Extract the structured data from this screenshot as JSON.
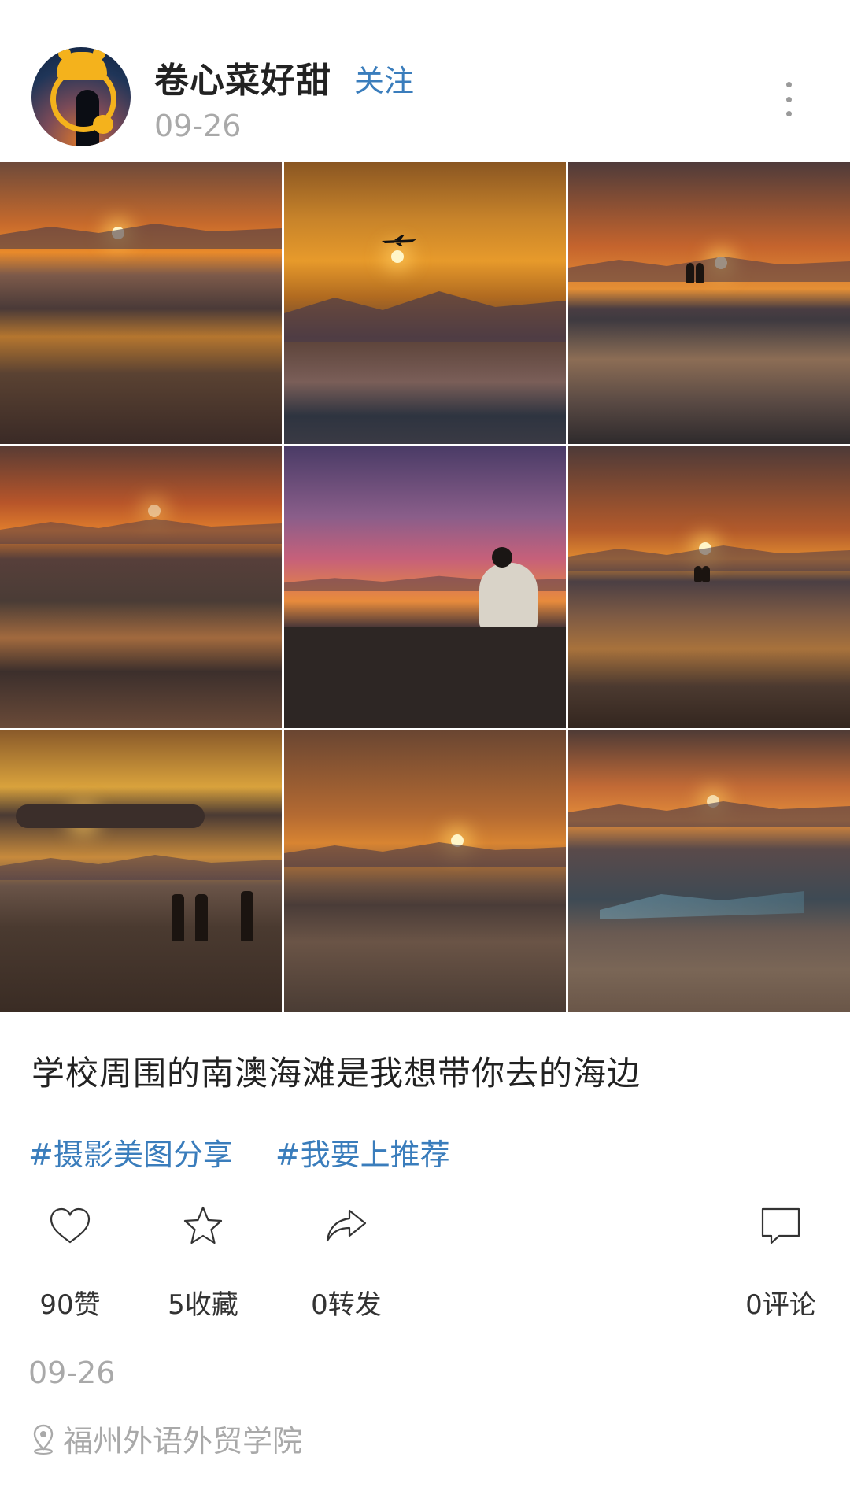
{
  "header": {
    "username": "卷心菜好甜",
    "follow_label": "关注",
    "date": "09-26"
  },
  "photos": [
    {
      "alt": "sunset-beach-1"
    },
    {
      "alt": "sunset-plane"
    },
    {
      "alt": "sunset-couple"
    },
    {
      "alt": "sunset-tidal-flat"
    },
    {
      "alt": "sunset-sitting-man"
    },
    {
      "alt": "sunset-shore"
    },
    {
      "alt": "sunset-three-people"
    },
    {
      "alt": "sunset-beach-2"
    },
    {
      "alt": "sunset-nets"
    }
  ],
  "post": {
    "caption": "学校周围的南澳海滩是我想带你去的海边",
    "tags": [
      "#摄影美图分享",
      "#我要上推荐"
    ]
  },
  "actions": {
    "like_count": "90赞",
    "favorite_count": "5收藏",
    "share_count": "0转发",
    "comment_count": "0评论"
  },
  "footer": {
    "date": "09-26",
    "location": "福州外语外贸学院"
  },
  "colors": {
    "accent": "#3a7dbc",
    "muted": "#a9a9a9",
    "text": "#222222"
  }
}
